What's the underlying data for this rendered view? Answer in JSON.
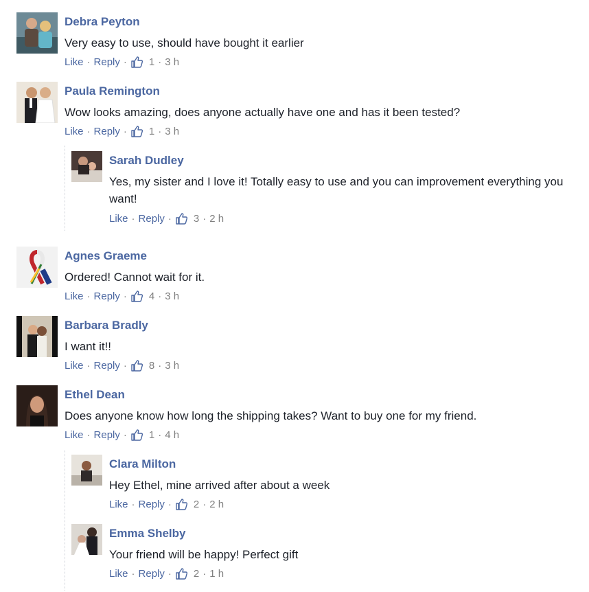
{
  "comments": [
    {
      "name": "Debra Peyton",
      "text": "Very easy to use, should have bought it earlier",
      "like": "Like",
      "reply": "Reply",
      "count": "1",
      "time": "3 h"
    },
    {
      "name": "Paula Remington",
      "text": "Wow looks amazing, does anyone actually have one and has it been tested?",
      "like": "Like",
      "reply": "Reply",
      "count": "1",
      "time": "3 h"
    },
    {
      "name": "Sarah Dudley",
      "text": "Yes, my sister and I love it! Totally easy to use and you can improvement everything you want!",
      "like": "Like",
      "reply": "Reply",
      "count": "3",
      "time": "2 h"
    },
    {
      "name": "Agnes Graeme",
      "text": "Ordered! Cannot wait for it.",
      "like": "Like",
      "reply": "Reply",
      "count": "4",
      "time": "3 h"
    },
    {
      "name": "Barbara Bradly",
      "text": "I want it!!",
      "like": "Like",
      "reply": "Reply",
      "count": "8",
      "time": "3 h"
    },
    {
      "name": "Ethel Dean",
      "text": "Does anyone know how long the shipping takes? Want to buy one for my friend.",
      "like": "Like",
      "reply": "Reply",
      "count": "1",
      "time": "4 h"
    },
    {
      "name": "Clara Milton",
      "text": "Hey Ethel, mine arrived after about a week",
      "like": "Like",
      "reply": "Reply",
      "count": "2",
      "time": "2 h"
    },
    {
      "name": "Emma Shelby",
      "text": "Your friend will be happy! Perfect gift",
      "like": "Like",
      "reply": "Reply",
      "count": "2",
      "time": "1 h"
    }
  ],
  "separator": "·",
  "icons": {
    "reaction": "thumbs-up-icon"
  },
  "colors": {
    "name": "#4b67a1",
    "text": "#1d2129",
    "meta": "#7f7f7f"
  }
}
